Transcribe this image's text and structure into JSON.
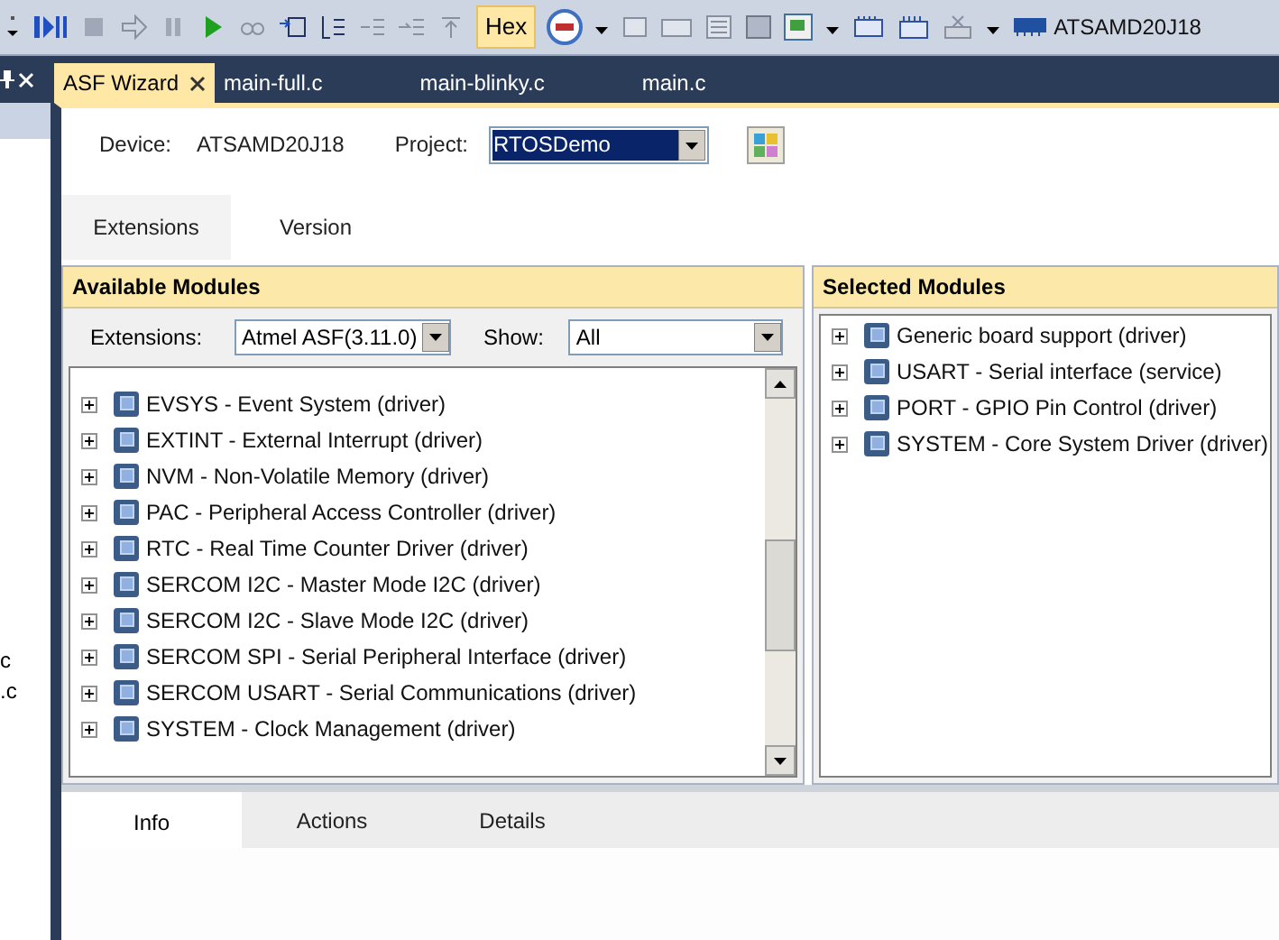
{
  "toolbar": {
    "hex": {
      "label": "Hex",
      "selected": true
    },
    "device": "ATSAMD20J18"
  },
  "side_panel": {
    "texts": [
      "c",
      ".c"
    ]
  },
  "document_tabs": [
    {
      "label": "ASF Wizard",
      "selected": true,
      "closable": true
    },
    {
      "label": "main-full.c",
      "selected": false,
      "closable": false
    },
    {
      "label": "main-blinky.c",
      "selected": false,
      "closable": false
    },
    {
      "label": "main.c",
      "selected": false,
      "closable": false
    }
  ],
  "wizard": {
    "device_label": "Device:",
    "device": "ATSAMD20J18",
    "project_label": "Project:",
    "project": "RTOSDemo",
    "tabs": [
      {
        "label": "Extensions",
        "selected": true
      },
      {
        "label": "Version",
        "selected": false
      }
    ],
    "available": {
      "title": "Available Modules",
      "extensions_label": "Extensions:",
      "extensions": "Atmel ASF(3.11.0)",
      "show_label": "Show:",
      "show": "All",
      "items": [
        {
          "label": "EVSYS - Event System (driver)",
          "expanded": false
        },
        {
          "label": "EXTINT - External Interrupt (driver)",
          "expanded": false
        },
        {
          "label": "NVM - Non-Volatile Memory (driver)",
          "expanded": false
        },
        {
          "label": "PAC - Peripheral Access Controller (driver)",
          "expanded": false
        },
        {
          "label": "RTC - Real Time Counter Driver (driver)",
          "expanded": false
        },
        {
          "label": "SERCOM I2C - Master Mode I2C (driver)",
          "expanded": false
        },
        {
          "label": "SERCOM I2C - Slave Mode I2C (driver)",
          "expanded": false
        },
        {
          "label": "SERCOM SPI - Serial Peripheral Interface (driver)",
          "expanded": false
        },
        {
          "label": "SERCOM USART - Serial Communications (driver)",
          "expanded": false
        },
        {
          "label": "SYSTEM - Clock Management (driver)",
          "expanded": false
        }
      ]
    },
    "selected": {
      "title": "Selected Modules",
      "items": [
        {
          "label": "Generic board support (driver)",
          "expanded": false
        },
        {
          "label": "USART - Serial interface (service)",
          "expanded": false
        },
        {
          "label": "PORT - GPIO Pin Control (driver)",
          "expanded": false
        },
        {
          "label": "SYSTEM - Core System Driver (driver)",
          "expanded": false
        }
      ]
    }
  },
  "bottom_tabs": [
    {
      "label": "Info",
      "selected": true
    },
    {
      "label": "Actions",
      "selected": false
    },
    {
      "label": "Details",
      "selected": false
    }
  ]
}
